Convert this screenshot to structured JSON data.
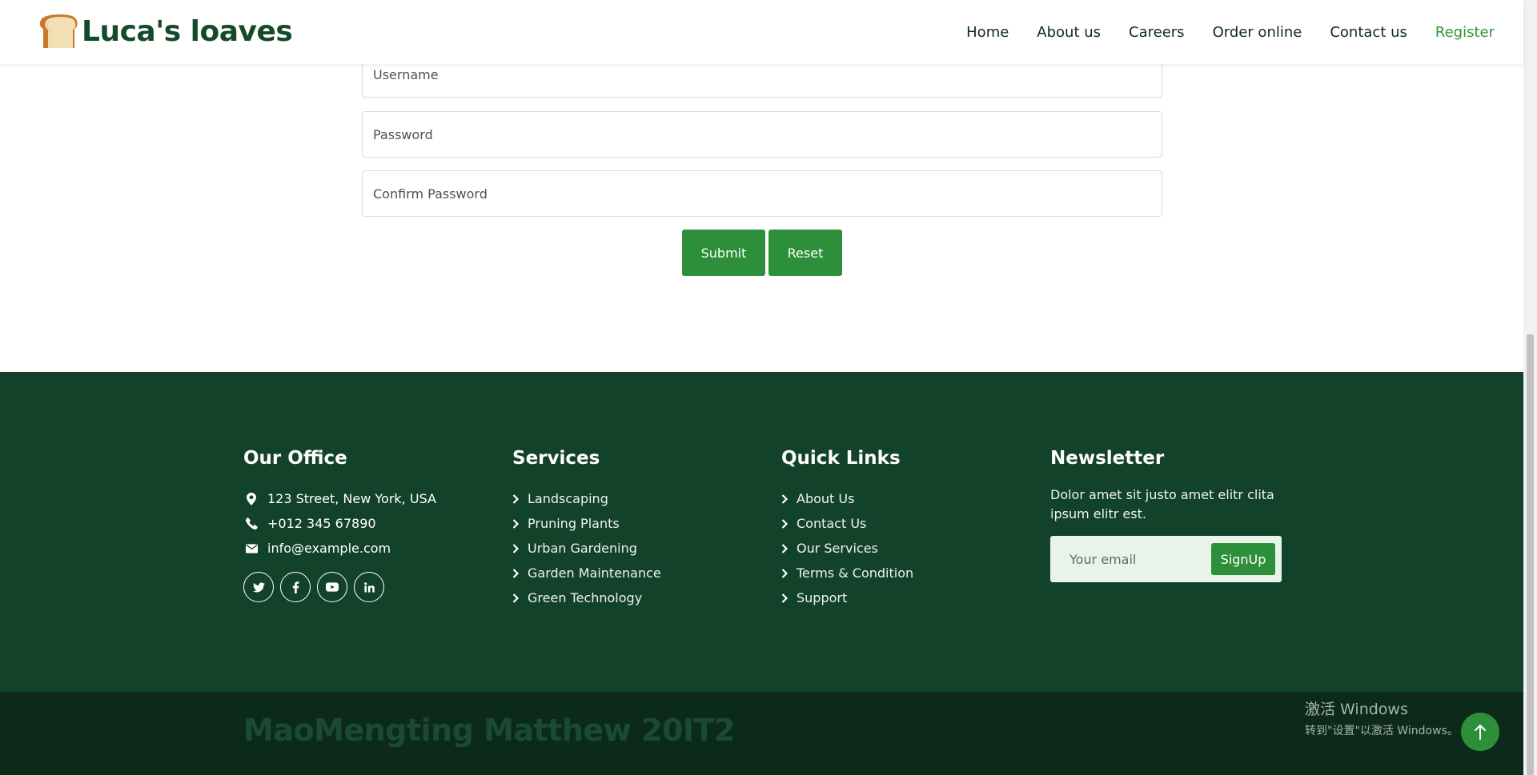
{
  "brand": {
    "name": "Luca's loaves",
    "logo_icon": "bread-icon"
  },
  "nav": {
    "items": [
      {
        "label": "Home"
      },
      {
        "label": "About us"
      },
      {
        "label": "Careers"
      },
      {
        "label": "Order online"
      },
      {
        "label": "Contact us"
      },
      {
        "label": "Register"
      }
    ],
    "active": "Register"
  },
  "form": {
    "username_placeholder": "Username",
    "password_placeholder": "Password",
    "confirm_placeholder": "Confirm Password",
    "submit_label": "Submit",
    "reset_label": "Reset"
  },
  "footer": {
    "office": {
      "title": "Our Office",
      "address": "123 Street, New York, USA",
      "phone": "+012 345 67890",
      "email": "info@example.com",
      "socials": [
        "twitter-icon",
        "facebook-icon",
        "youtube-icon",
        "linkedin-icon"
      ]
    },
    "services": {
      "title": "Services",
      "items": [
        "Landscaping",
        "Pruning Plants",
        "Urban Gardening",
        "Garden Maintenance",
        "Green Technology"
      ]
    },
    "quick_links": {
      "title": "Quick Links",
      "items": [
        "About Us",
        "Contact Us",
        "Our Services",
        "Terms & Condition",
        "Support"
      ]
    },
    "newsletter": {
      "title": "Newsletter",
      "text": "Dolor amet sit justo amet elitr clita ipsum elitr est.",
      "email_placeholder": "Your email",
      "button_label": "SignUp"
    }
  },
  "copyright": "MaoMengting Matthew 20IT2",
  "windows_watermark": {
    "line1": "激活 Windows",
    "line2": "转到\"设置\"以激活 Windows。"
  },
  "colors": {
    "accent_green": "#2e8f3a",
    "footer_bg": "#13422b",
    "copyright_bg": "#0c2a1a",
    "brand_text": "#144a2b"
  }
}
